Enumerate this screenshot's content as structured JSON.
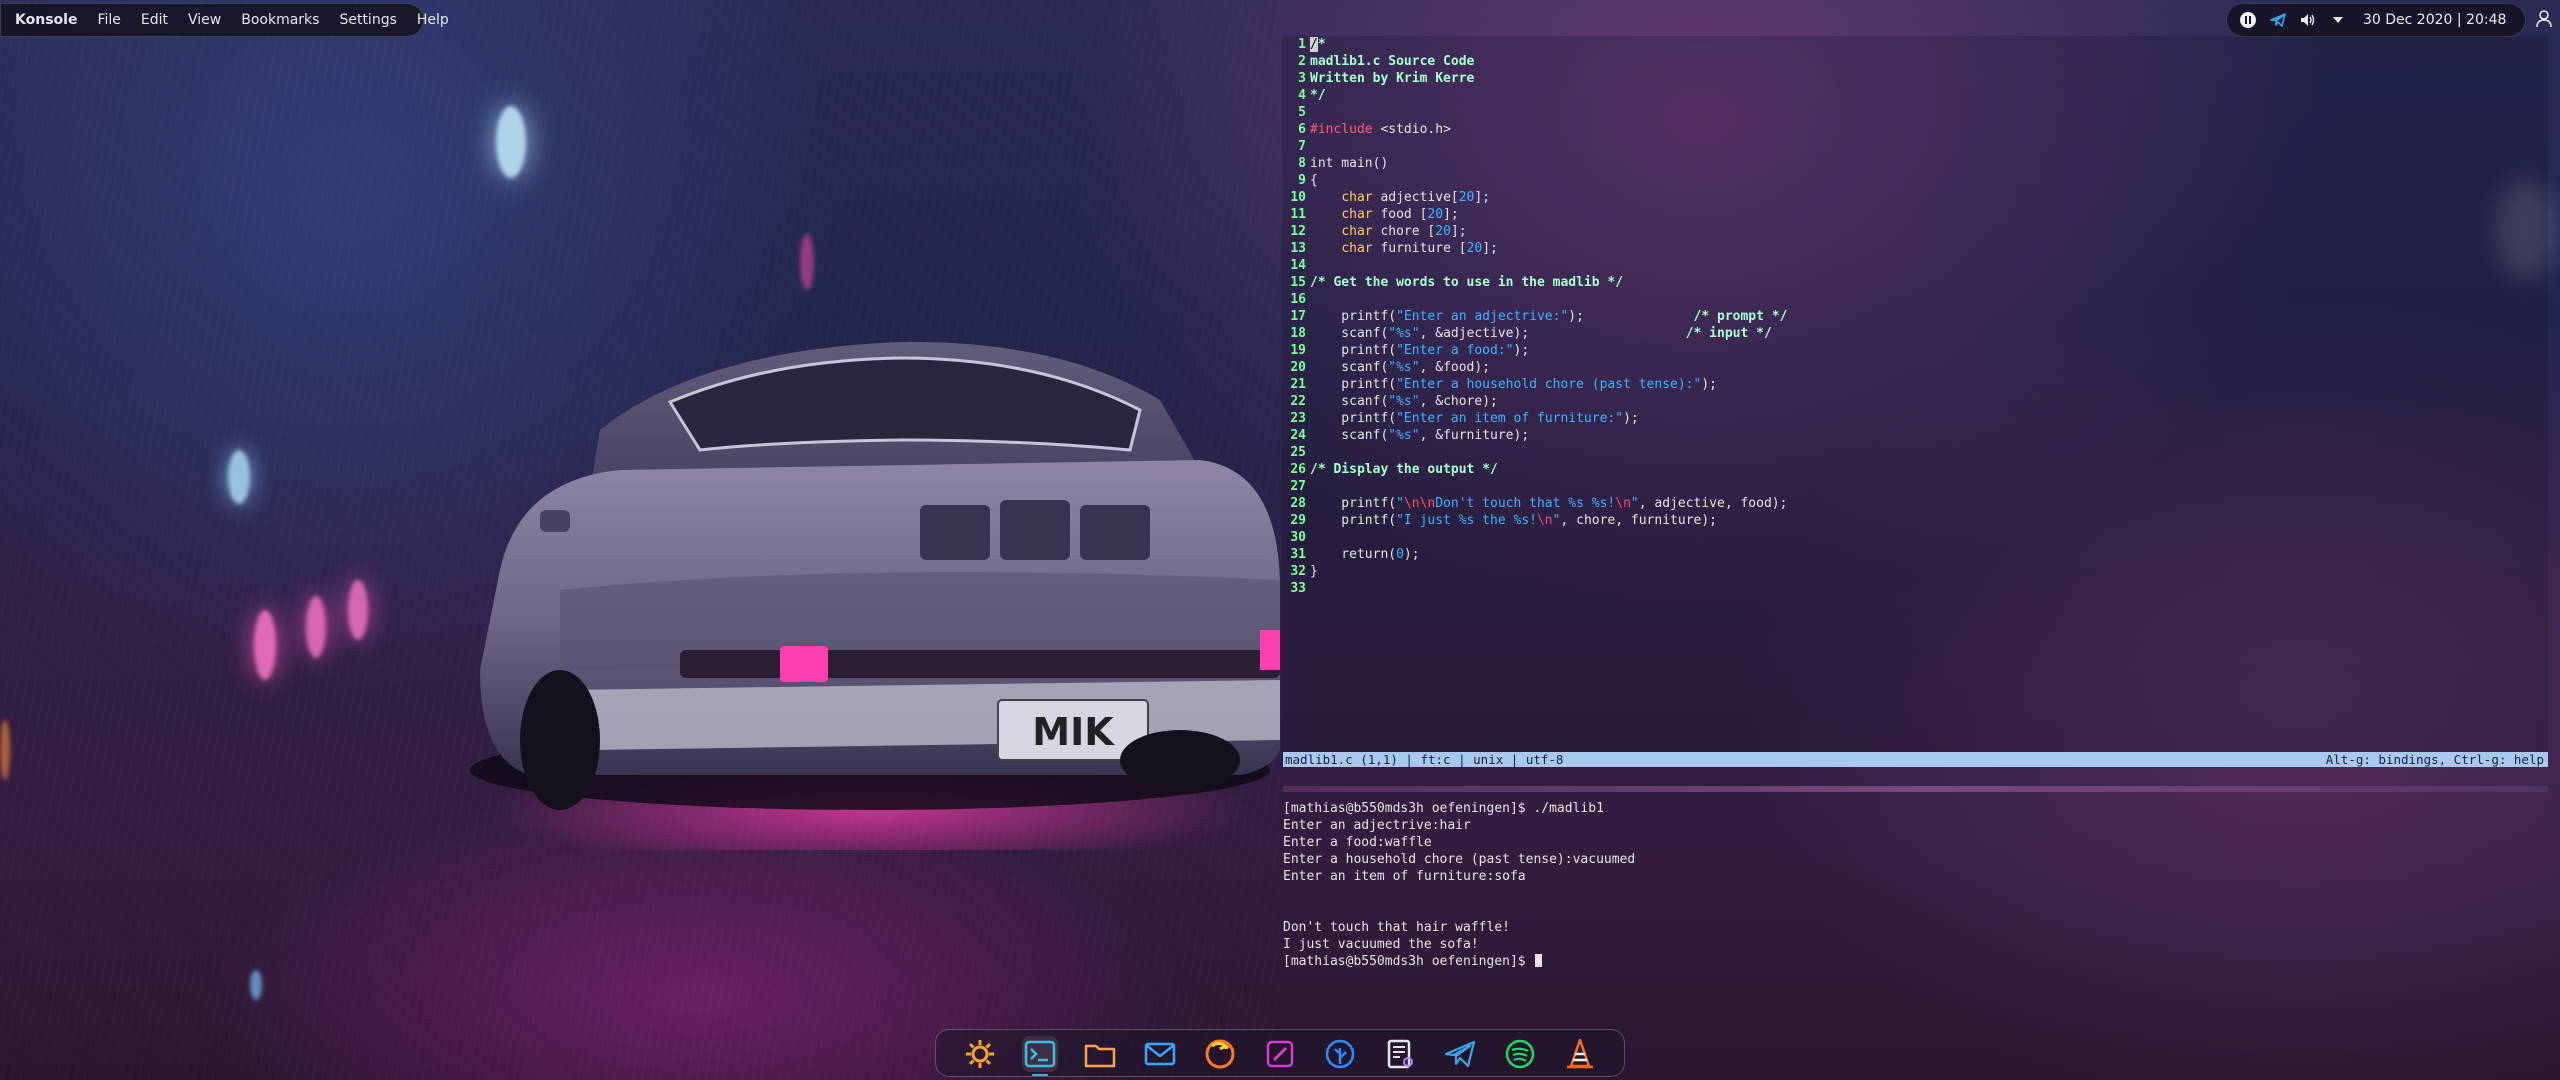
{
  "window": {
    "app_name": "Konsole",
    "menu": [
      "File",
      "Edit",
      "View",
      "Bookmarks",
      "Settings",
      "Help"
    ]
  },
  "tray": {
    "icons": [
      "media-pause-icon",
      "telegram-icon",
      "volume-icon",
      "tray-expand-arrow-icon"
    ],
    "clock": "30 Dec 2020 | 20:48"
  },
  "wallpaper": {
    "license_plate": "MIK"
  },
  "editor": {
    "lines": [
      {
        "n": "1",
        "segs": [
          {
            "t": "/",
            "c": "t-cursor"
          },
          {
            "t": "*",
            "c": "t-comment"
          }
        ]
      },
      {
        "n": "2",
        "segs": [
          {
            "t": "madlib1.c Source Code",
            "c": "t-comment"
          }
        ]
      },
      {
        "n": "3",
        "segs": [
          {
            "t": "Written by Krim Kerre",
            "c": "t-comment"
          }
        ]
      },
      {
        "n": "4",
        "segs": [
          {
            "t": "*/",
            "c": "t-comment"
          }
        ]
      },
      {
        "n": "5",
        "segs": []
      },
      {
        "n": "6",
        "segs": [
          {
            "t": "#include",
            "c": "t-preproc"
          },
          {
            "t": " <stdio.h>",
            "c": "code-text"
          }
        ]
      },
      {
        "n": "7",
        "segs": []
      },
      {
        "n": "8",
        "segs": [
          {
            "t": "int main()",
            "c": "code-text"
          }
        ]
      },
      {
        "n": "9",
        "segs": [
          {
            "t": "{",
            "c": "code-text"
          }
        ]
      },
      {
        "n": "10",
        "segs": [
          {
            "t": "    ",
            "c": "code-text"
          },
          {
            "t": "char",
            "c": "t-type"
          },
          {
            "t": " adjective[",
            "c": "code-text"
          },
          {
            "t": "20",
            "c": "t-num"
          },
          {
            "t": "];",
            "c": "code-text"
          }
        ]
      },
      {
        "n": "11",
        "segs": [
          {
            "t": "    ",
            "c": "code-text"
          },
          {
            "t": "char",
            "c": "t-type"
          },
          {
            "t": " food [",
            "c": "code-text"
          },
          {
            "t": "20",
            "c": "t-num"
          },
          {
            "t": "];",
            "c": "code-text"
          }
        ]
      },
      {
        "n": "12",
        "segs": [
          {
            "t": "    ",
            "c": "code-text"
          },
          {
            "t": "char",
            "c": "t-type"
          },
          {
            "t": " chore [",
            "c": "code-text"
          },
          {
            "t": "20",
            "c": "t-num"
          },
          {
            "t": "];",
            "c": "code-text"
          }
        ]
      },
      {
        "n": "13",
        "segs": [
          {
            "t": "    ",
            "c": "code-text"
          },
          {
            "t": "char",
            "c": "t-type"
          },
          {
            "t": " furniture [",
            "c": "code-text"
          },
          {
            "t": "20",
            "c": "t-num"
          },
          {
            "t": "];",
            "c": "code-text"
          }
        ]
      },
      {
        "n": "14",
        "segs": []
      },
      {
        "n": "15",
        "segs": [
          {
            "t": "/* Get the words to use in the madlib */",
            "c": "t-comment"
          }
        ]
      },
      {
        "n": "16",
        "segs": []
      },
      {
        "n": "17",
        "segs": [
          {
            "t": "    printf(",
            "c": "code-text"
          },
          {
            "t": "\"Enter an adjectrive:\"",
            "c": "t-str"
          },
          {
            "t": ");              ",
            "c": "code-text"
          },
          {
            "t": "/* prompt */",
            "c": "t-comment"
          }
        ]
      },
      {
        "n": "18",
        "segs": [
          {
            "t": "    scanf(",
            "c": "code-text"
          },
          {
            "t": "\"%s\"",
            "c": "t-str"
          },
          {
            "t": ", &adjective);                    ",
            "c": "code-text"
          },
          {
            "t": "/* input */",
            "c": "t-comment"
          }
        ]
      },
      {
        "n": "19",
        "segs": [
          {
            "t": "    printf(",
            "c": "code-text"
          },
          {
            "t": "\"Enter a food:\"",
            "c": "t-str"
          },
          {
            "t": ");",
            "c": "code-text"
          }
        ]
      },
      {
        "n": "20",
        "segs": [
          {
            "t": "    scanf(",
            "c": "code-text"
          },
          {
            "t": "\"%s\"",
            "c": "t-str"
          },
          {
            "t": ", &food);",
            "c": "code-text"
          }
        ]
      },
      {
        "n": "21",
        "segs": [
          {
            "t": "    printf(",
            "c": "code-text"
          },
          {
            "t": "\"Enter a household chore (past tense):\"",
            "c": "t-str"
          },
          {
            "t": ");",
            "c": "code-text"
          }
        ]
      },
      {
        "n": "22",
        "segs": [
          {
            "t": "    scanf(",
            "c": "code-text"
          },
          {
            "t": "\"%s\"",
            "c": "t-str"
          },
          {
            "t": ", &chore);",
            "c": "code-text"
          }
        ]
      },
      {
        "n": "23",
        "segs": [
          {
            "t": "    printf(",
            "c": "code-text"
          },
          {
            "t": "\"Enter an item of furniture:\"",
            "c": "t-str"
          },
          {
            "t": ");",
            "c": "code-text"
          }
        ]
      },
      {
        "n": "24",
        "segs": [
          {
            "t": "    scanf(",
            "c": "code-text"
          },
          {
            "t": "\"%s\"",
            "c": "t-str"
          },
          {
            "t": ", &furniture);",
            "c": "code-text"
          }
        ]
      },
      {
        "n": "25",
        "segs": []
      },
      {
        "n": "26",
        "segs": [
          {
            "t": "/* Display the output */",
            "c": "t-comment"
          }
        ]
      },
      {
        "n": "27",
        "segs": []
      },
      {
        "n": "28",
        "segs": [
          {
            "t": "    printf(",
            "c": "code-text"
          },
          {
            "t": "\"",
            "c": "t-str"
          },
          {
            "t": "\\n\\n",
            "c": "t-esc"
          },
          {
            "t": "Don't touch that %s %s!",
            "c": "t-str"
          },
          {
            "t": "\\n",
            "c": "t-esc"
          },
          {
            "t": "\"",
            "c": "t-str"
          },
          {
            "t": ", adjective, food);",
            "c": "code-text"
          }
        ]
      },
      {
        "n": "29",
        "segs": [
          {
            "t": "    printf(",
            "c": "code-text"
          },
          {
            "t": "\"I just %s the %s!",
            "c": "t-str"
          },
          {
            "t": "\\n",
            "c": "t-esc"
          },
          {
            "t": "\"",
            "c": "t-str"
          },
          {
            "t": ", chore, furniture);",
            "c": "code-text"
          }
        ]
      },
      {
        "n": "30",
        "segs": []
      },
      {
        "n": "31",
        "segs": [
          {
            "t": "    return(",
            "c": "code-text"
          },
          {
            "t": "0",
            "c": "t-num"
          },
          {
            "t": ");",
            "c": "code-text"
          }
        ]
      },
      {
        "n": "32",
        "segs": [
          {
            "t": "}",
            "c": "code-text"
          }
        ]
      },
      {
        "n": "33",
        "segs": []
      }
    ],
    "status_left": "madlib1.c (1,1) | ft:c | unix | utf-8",
    "status_right": "Alt-g: bindings, Ctrl-g: help"
  },
  "terminal": {
    "lines": [
      "[mathias@b550mds3h oefeningen]$ ./madlib1",
      "Enter an adjectrive:hair",
      "Enter a food:waffle",
      "Enter a household chore (past tense):vacuumed",
      "Enter an item of furniture:sofa",
      "",
      "",
      "Don't touch that hair waffle!",
      "I just vacuumed the sofa!",
      "[mathias@b550mds3h oefeningen]$ "
    ]
  },
  "dock": {
    "items": [
      {
        "name": "settings",
        "icon": "gear-icon",
        "color": "#f5a623"
      },
      {
        "name": "konsole",
        "icon": "terminal-icon",
        "color": "#33c3e0",
        "active": true
      },
      {
        "name": "files",
        "icon": "folder-icon",
        "color": "#f7a44a"
      },
      {
        "name": "mail",
        "icon": "mail-icon",
        "color": "#39a7ff"
      },
      {
        "name": "firefox",
        "icon": "firefox-icon",
        "color": "#ff7a1f"
      },
      {
        "name": "color-picker",
        "icon": "brush-icon",
        "color": "#d43ed4"
      },
      {
        "name": "krita",
        "icon": "leaf-icon",
        "color": "#2b8cff"
      },
      {
        "name": "text-editor",
        "icon": "document-edit-icon",
        "color": "#e6e6ef"
      },
      {
        "name": "telegram",
        "icon": "telegram-icon",
        "color": "#3aa7e8"
      },
      {
        "name": "spotify",
        "icon": "spotify-icon",
        "color": "#1ed760"
      },
      {
        "name": "vlc",
        "icon": "traffic-cone-icon",
        "color": "#ff6a1a"
      }
    ]
  },
  "colors": {
    "line_number": "#7dff9b",
    "comment": "#a8ffcf",
    "string": "#3fb3ff",
    "type": "#ffd04a",
    "preproc": "#ff5a7a",
    "statusbar": "#a9c8f0"
  }
}
